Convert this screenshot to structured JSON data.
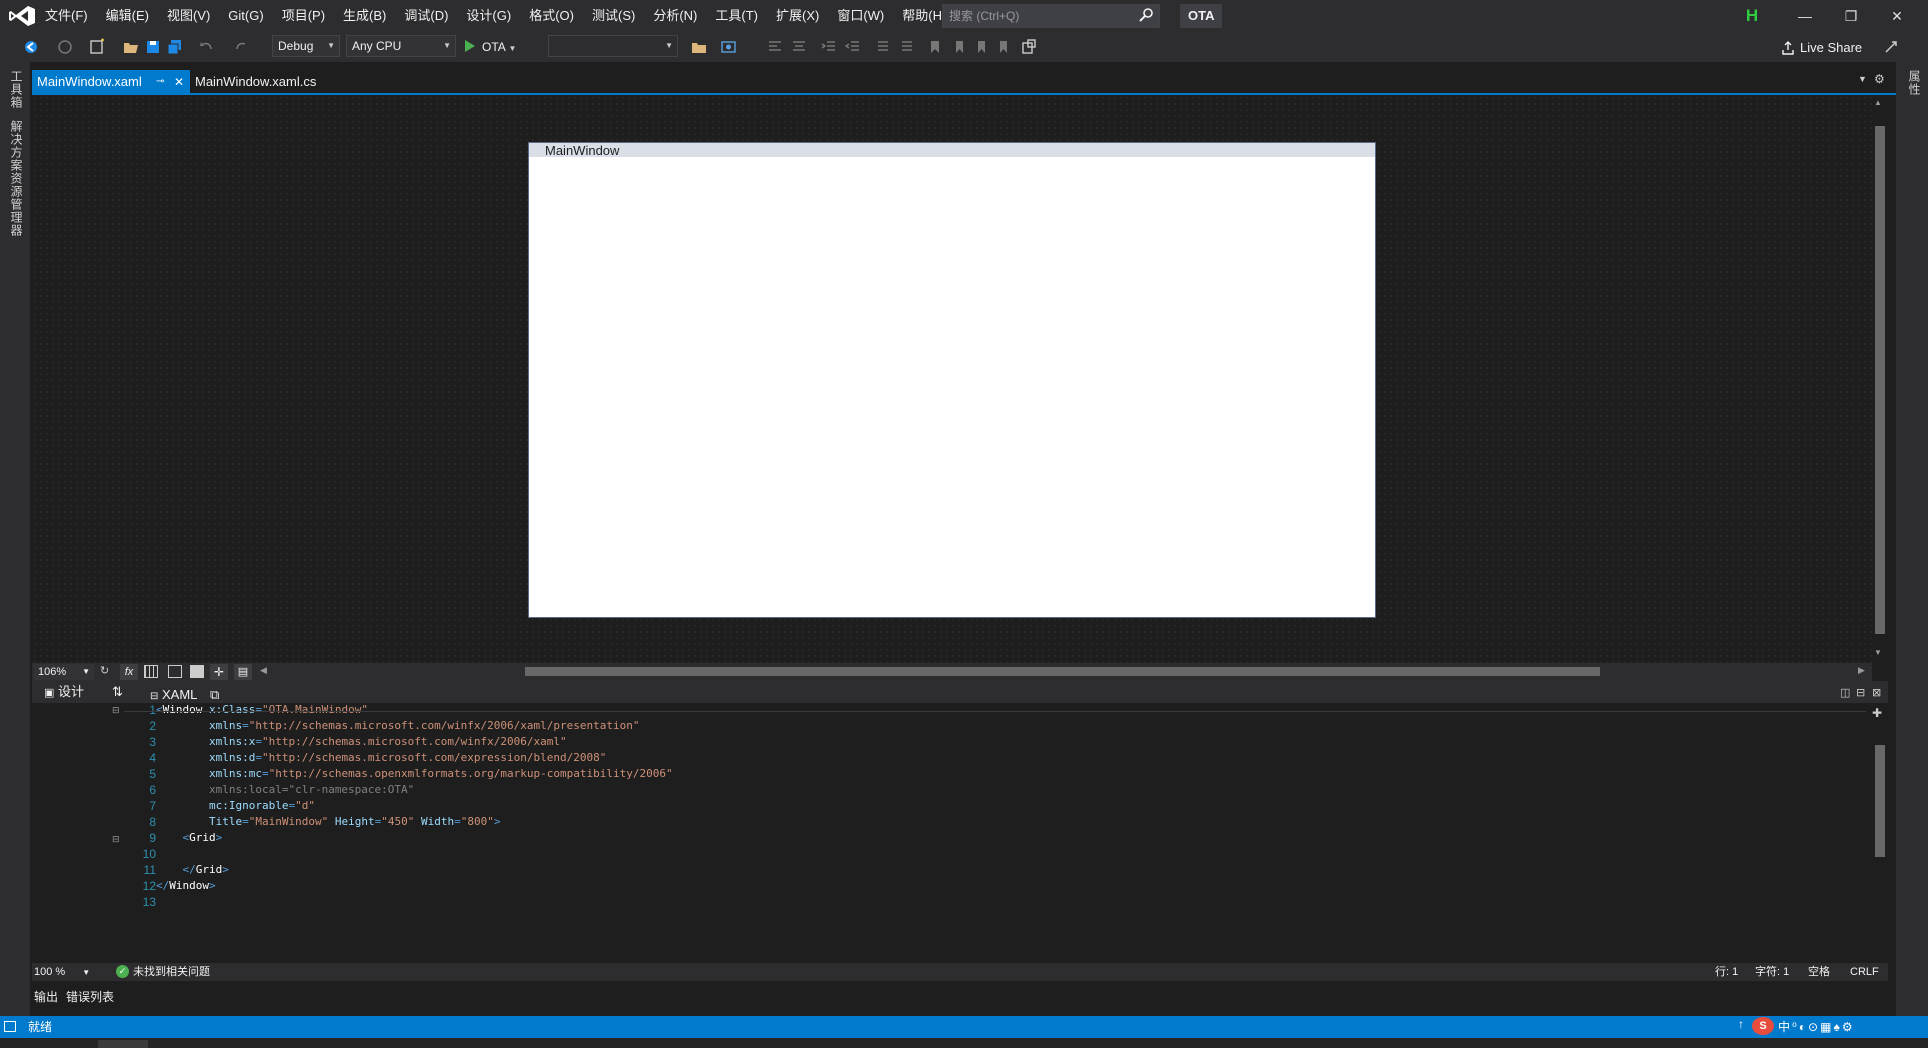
{
  "menu": {
    "items": [
      "文件(F)",
      "编辑(E)",
      "视图(V)",
      "Git(G)",
      "项目(P)",
      "生成(B)",
      "调试(D)",
      "设计(G)",
      "格式(O)",
      "测试(S)",
      "分析(N)",
      "工具(T)",
      "扩展(X)",
      "窗口(W)",
      "帮助(H)"
    ],
    "search_placeholder": "搜索 (Ctrl+Q)",
    "solution_name": "OTA",
    "profile_initial": "H"
  },
  "toolbar": {
    "config": "Debug",
    "platform": "Any CPU",
    "run_target": "OTA",
    "live_share": "Live Share"
  },
  "left_rail": {
    "toolbox": "工具箱",
    "solution_explorer": "解决方案资源管理器"
  },
  "right_rail": {
    "properties": "属性"
  },
  "tabs": {
    "active": "MainWindow.xaml",
    "inactive": "MainWindow.xaml.cs"
  },
  "designer": {
    "window_title": "MainWindow",
    "zoom": "106%",
    "fx": "fx"
  },
  "pane": {
    "design_tab": "设计",
    "xaml_tab": "XAML"
  },
  "editor": {
    "line_numbers": [
      "1",
      "2",
      "3",
      "4",
      "5",
      "6",
      "7",
      "8",
      "9",
      "10",
      "11",
      "12",
      "13"
    ]
  },
  "editor_status": {
    "zoom": "100 %",
    "issues": "未找到相关问题",
    "line": "行: 1",
    "char": "字符: 1",
    "spaces": "空格",
    "eol": "CRLF"
  },
  "output_tabs": [
    "输出",
    "错误列表"
  ],
  "statusbar": {
    "ready": "就绪"
  },
  "colors": {
    "accent": "#007acc",
    "chrome": "#2d2d30",
    "editor_bg": "#1e1e1e"
  }
}
